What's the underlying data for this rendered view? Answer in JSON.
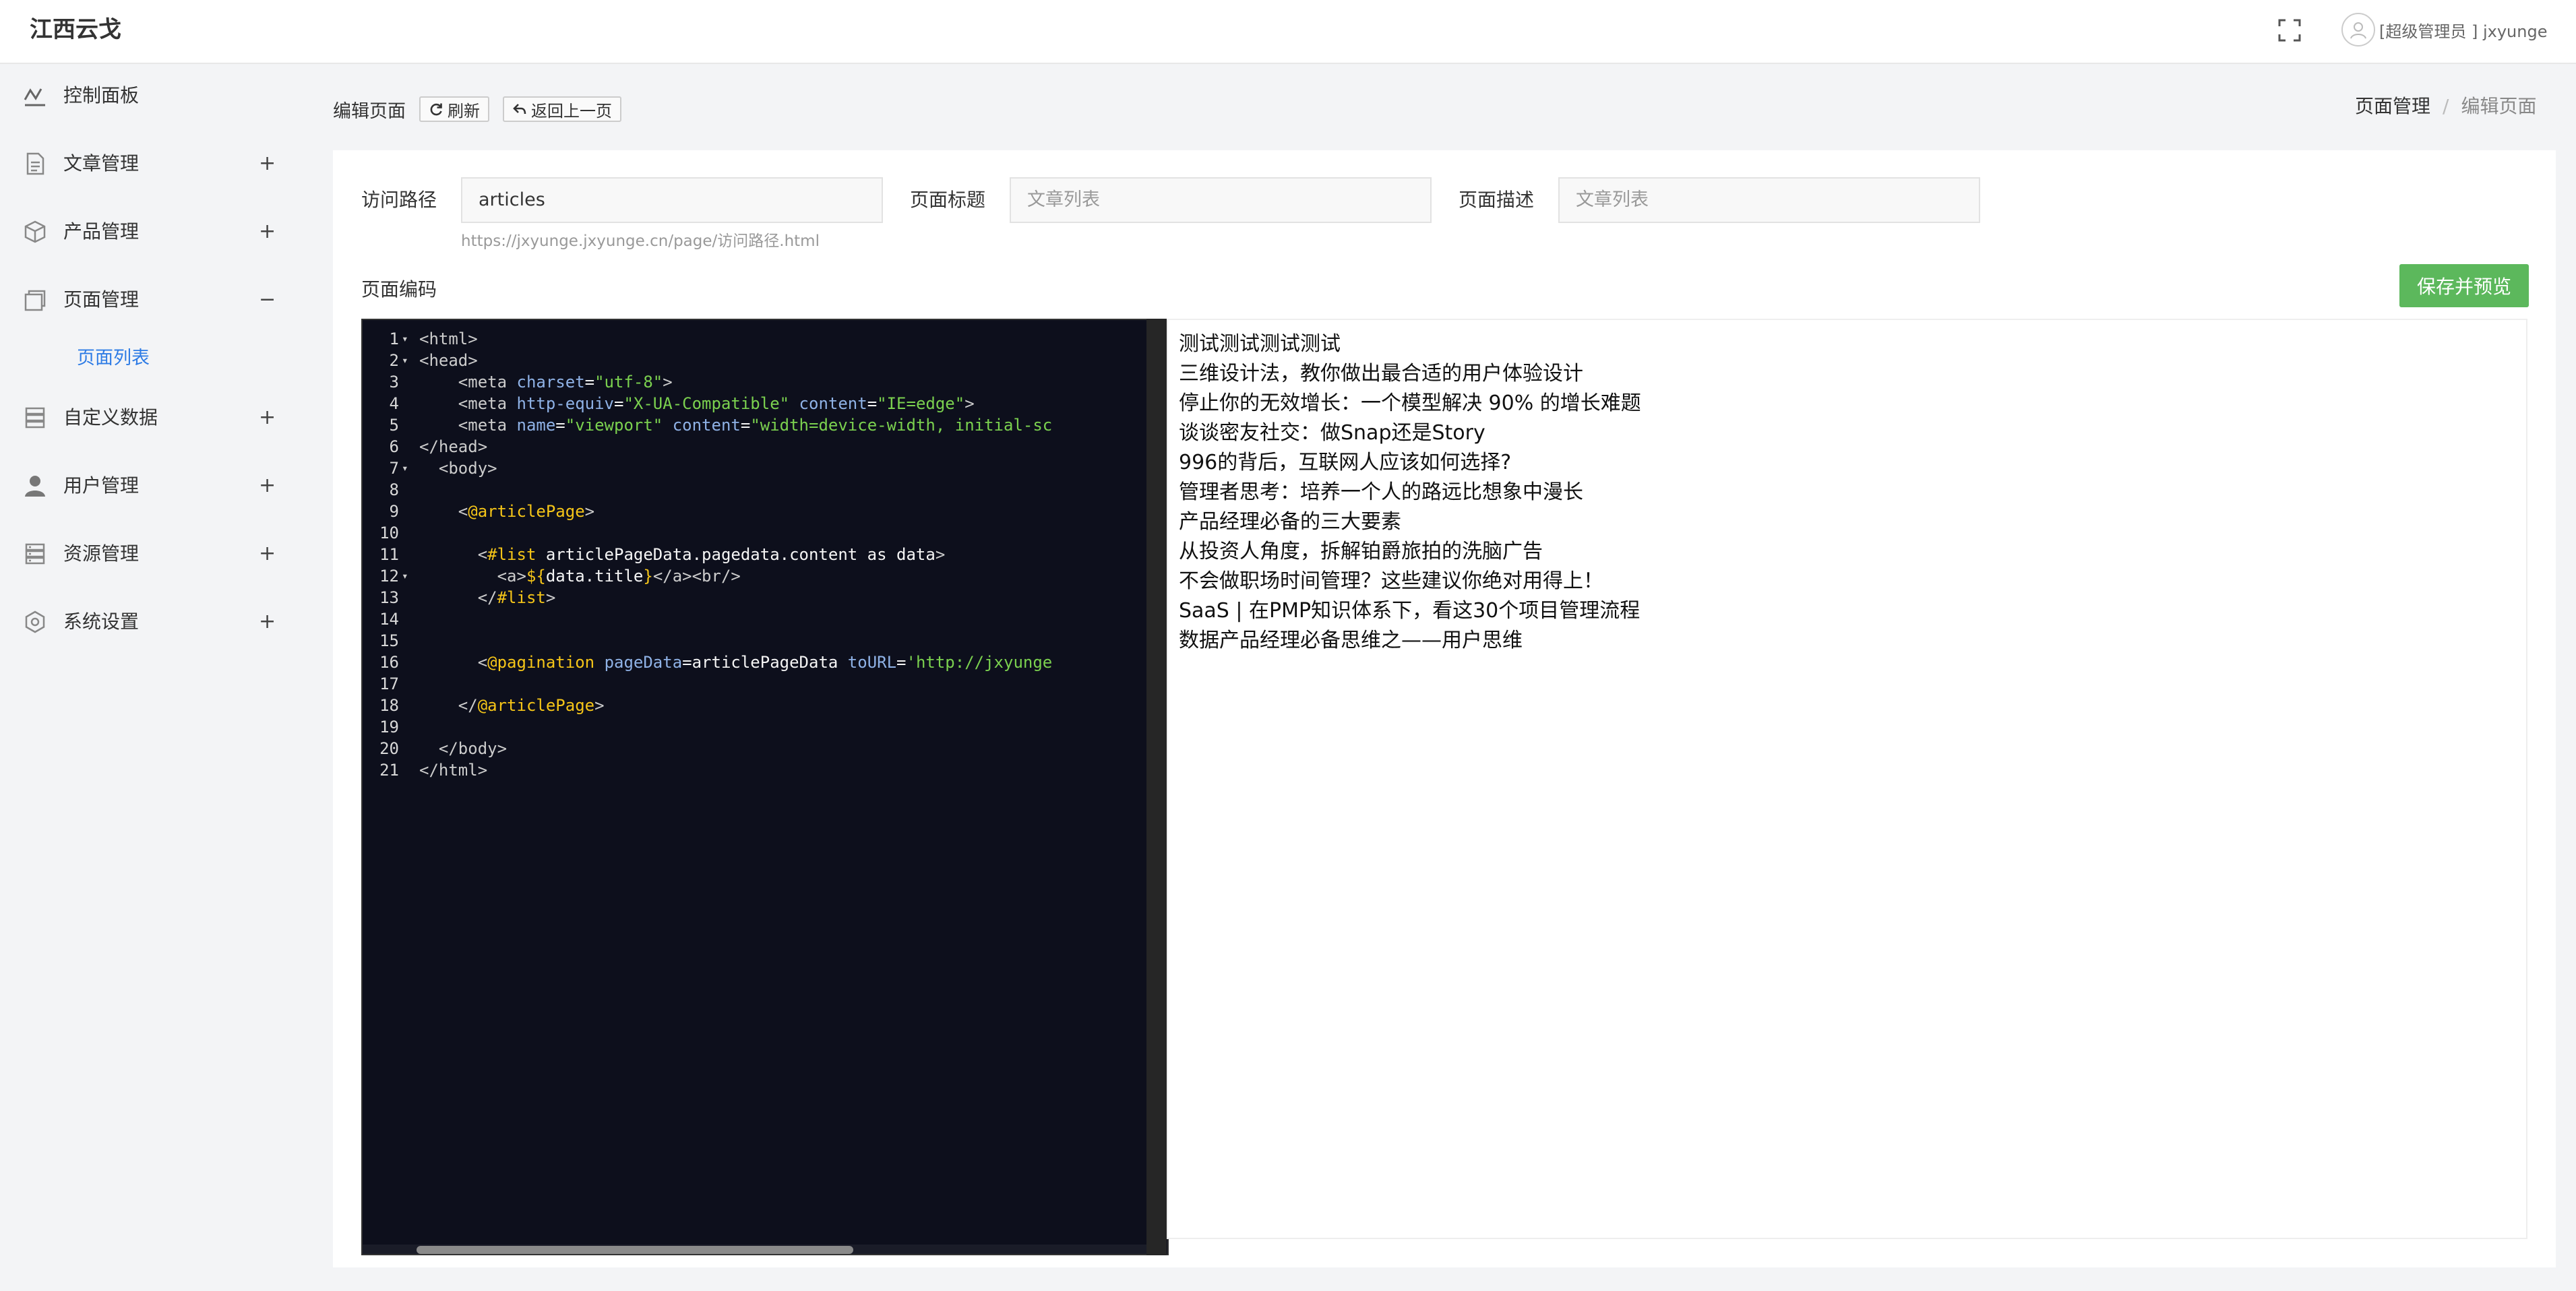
{
  "app": {
    "title": "江西云戈"
  },
  "header": {
    "user_label": "[超级管理员 ] jxyunge"
  },
  "sidebar": {
    "items": [
      {
        "label": "控制面板",
        "icon": "dashboard-icon",
        "toggle": ""
      },
      {
        "label": "文章管理",
        "icon": "document-icon",
        "toggle": "+"
      },
      {
        "label": "产品管理",
        "icon": "cube-icon",
        "toggle": "+"
      },
      {
        "label": "页面管理",
        "icon": "page-stack-icon",
        "toggle": "−"
      },
      {
        "label": "自定义数据",
        "icon": "database-icon",
        "toggle": "+"
      },
      {
        "label": "用户管理",
        "icon": "user-icon",
        "toggle": "+"
      },
      {
        "label": "资源管理",
        "icon": "storage-icon",
        "toggle": "+"
      },
      {
        "label": "系统设置",
        "icon": "settings-icon",
        "toggle": "+"
      }
    ],
    "sub_item": "页面列表"
  },
  "page": {
    "heading": "编辑页面",
    "refresh_label": "刷新",
    "back_label": "返回上一页",
    "breadcrumb": [
      "页面管理",
      "/",
      "编辑页面"
    ]
  },
  "form": {
    "path_label": "访问路径",
    "path_value": "articles",
    "title_label": "页面标题",
    "title_placeholder": "文章列表",
    "desc_label": "页面描述",
    "desc_placeholder": "文章列表",
    "path_hint": "https://jxyunge.jxyunge.cn/page/访问路径.html",
    "code_label": "页面编码",
    "save_label": "保存并预览"
  },
  "editor": {
    "lines": [
      {
        "n": "1",
        "fold": "▾",
        "html": "<span class=\"tag\">&lt;html&gt;</span>"
      },
      {
        "n": "2",
        "fold": "▾",
        "html": "<span class=\"tag\">&lt;head&gt;</span>"
      },
      {
        "n": "3",
        "fold": "",
        "html": "    <span class=\"tag\">&lt;meta</span> <span class=\"attr\">charset</span>=<span class=\"str\">\"utf-8\"</span><span class=\"tag\">&gt;</span>"
      },
      {
        "n": "4",
        "fold": "",
        "html": "    <span class=\"tag\">&lt;meta</span> <span class=\"attr\">http-equiv</span>=<span class=\"str\">\"X-UA-Compatible\"</span> <span class=\"attr\">content</span>=<span class=\"str\">\"IE=edge\"</span><span class=\"tag\">&gt;</span>"
      },
      {
        "n": "5",
        "fold": "",
        "html": "    <span class=\"tag\">&lt;meta</span> <span class=\"attr\">name</span>=<span class=\"str\">\"viewport\"</span> <span class=\"attr\">content</span>=<span class=\"str\">\"width=device-width, initial-sc</span>"
      },
      {
        "n": "6",
        "fold": "",
        "html": "<span class=\"tag\">&lt;/head&gt;</span>"
      },
      {
        "n": "7",
        "fold": "▾",
        "html": "  <span class=\"tag\">&lt;body&gt;</span>"
      },
      {
        "n": "8",
        "fold": "",
        "html": ""
      },
      {
        "n": "9",
        "fold": "",
        "html": "    <span class=\"tag\">&lt;</span><span class=\"kw\">@articlePage</span><span class=\"tag\">&gt;</span>"
      },
      {
        "n": "10",
        "fold": "",
        "html": ""
      },
      {
        "n": "11",
        "fold": "",
        "html": "      <span class=\"tag\">&lt;</span><span class=\"kw\">#list</span> articlePageData.pagedata.content as data<span class=\"tag\">&gt;</span>"
      },
      {
        "n": "12",
        "fold": "▾",
        "html": "        <span class=\"tag\">&lt;a&gt;</span><span class=\"kw\">${</span>data.title<span class=\"kw\">}</span><span class=\"tag\">&lt;/a&gt;&lt;br/&gt;</span>"
      },
      {
        "n": "13",
        "fold": "",
        "html": "      <span class=\"tag\">&lt;/</span><span class=\"kw\">#list</span><span class=\"tag\">&gt;</span>"
      },
      {
        "n": "14",
        "fold": "",
        "html": ""
      },
      {
        "n": "15",
        "fold": "",
        "html": ""
      },
      {
        "n": "16",
        "fold": "",
        "html": "      <span class=\"tag\">&lt;</span><span class=\"kw\">@pagination</span> <span class=\"attr\">pageData</span>=articlePageData <span class=\"attr\">toURL</span>=<span class=\"str\">'http://jxyunge</span>"
      },
      {
        "n": "17",
        "fold": "",
        "html": ""
      },
      {
        "n": "18",
        "fold": "",
        "html": "    <span class=\"tag\">&lt;/</span><span class=\"kw\">@articlePage</span><span class=\"tag\">&gt;</span>"
      },
      {
        "n": "19",
        "fold": "",
        "html": ""
      },
      {
        "n": "20",
        "fold": "",
        "html": "  <span class=\"tag\">&lt;/body&gt;</span>"
      },
      {
        "n": "21",
        "fold": "",
        "html": "<span class=\"tag\">&lt;/html&gt;</span>"
      }
    ]
  },
  "preview": {
    "links": [
      "测试测试测试测试",
      "三维设计法，教你做出最合适的用户体验设计",
      "停止你的无效增长：一个模型解决 90% 的增长难题",
      "谈谈密友社交：做Snap还是Story",
      "996的背后，互联网人应该如何选择?",
      "管理者思考：培养一个人的路远比想象中漫长",
      "产品经理必备的三大要素",
      "从投资人角度，拆解铂爵旅拍的洗脑广告",
      "不会做职场时间管理？这些建议你绝对用得上！",
      "SaaS | 在PMP知识体系下，看这30个项目管理流程",
      "数据产品经理必备思维之——用户思维"
    ]
  }
}
